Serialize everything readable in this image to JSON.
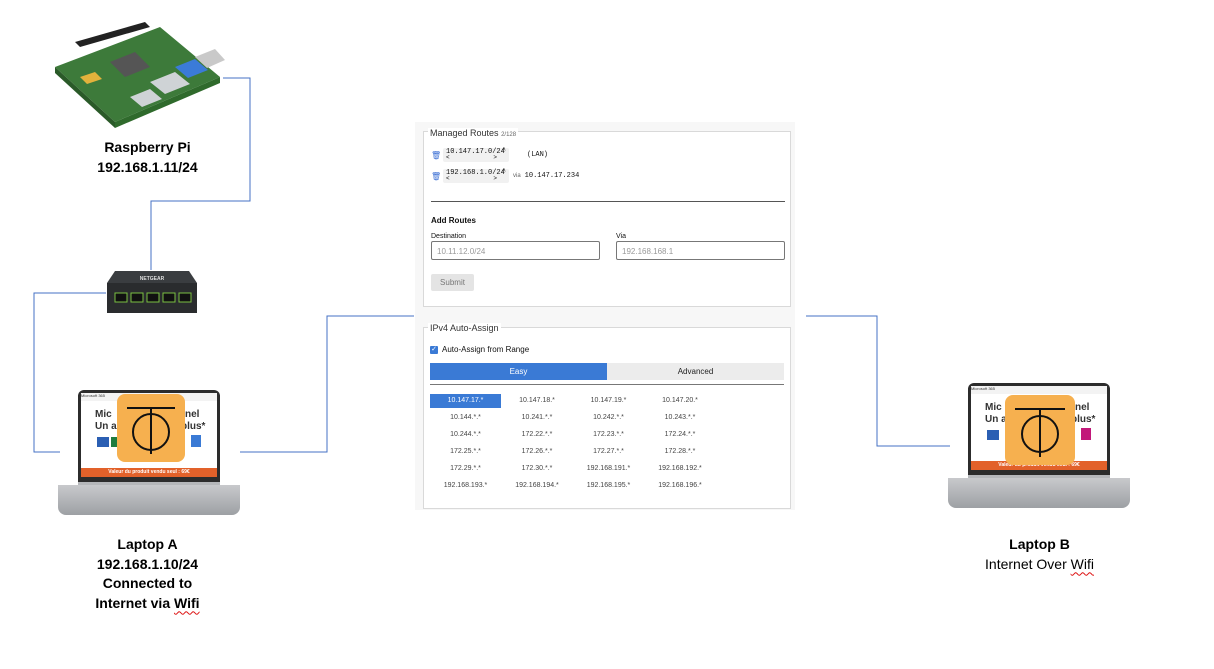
{
  "devices": {
    "raspberry_pi": {
      "name": "Raspberry Pi",
      "ip": "192.168.1.11/24"
    },
    "switch": {
      "brand": "NETGEAR"
    },
    "laptop_a": {
      "name": "Laptop A",
      "ip": "192.168.1.10/24",
      "note_line1": "Connected to",
      "note_line2_prefix": "Internet via ",
      "note_line2_word": "Wifi"
    },
    "laptop_b": {
      "name": "Laptop B",
      "note_prefix": "Internet Over ",
      "note_word": "Wifi"
    }
  },
  "laptop_screen": {
    "top_bar": "Microsoft 365",
    "headline_a": "Mic",
    "headline_b": "nel",
    "headline_c": "Un an",
    "headline_d": "plus*",
    "banner": "Valeur du produit vendu seul : 69€"
  },
  "panel": {
    "managed_routes": {
      "title": "Managed Routes",
      "count": "2/128",
      "routes": [
        {
          "value": "10.147.17.0/24",
          "via_label": "",
          "via": "(LAN)"
        },
        {
          "value": "192.168.1.0/24",
          "via_label": "via",
          "via": "10.147.17.234"
        }
      ]
    },
    "add_routes": {
      "title": "Add Routes",
      "destination_label": "Destination",
      "destination_placeholder": "10.11.12.0/24",
      "via_label": "Via",
      "via_placeholder": "192.168.168.1",
      "submit_label": "Submit"
    },
    "ipv4": {
      "title": "IPv4 Auto-Assign",
      "checkbox_label": "Auto-Assign from Range",
      "checked": true,
      "tabs": [
        "Easy",
        "Advanced"
      ],
      "active_tab": "Easy",
      "ranges": [
        "10.147.17.*",
        "10.147.18.*",
        "10.147.19.*",
        "10.147.20.*",
        "10.144.*.*",
        "10.241.*.*",
        "10.242.*.*",
        "10.243.*.*",
        "10.244.*.*",
        "172.22.*.*",
        "172.23.*.*",
        "172.24.*.*",
        "172.25.*.*",
        "172.26.*.*",
        "172.27.*.*",
        "172.28.*.*",
        "172.29.*.*",
        "172.30.*.*",
        "192.168.191.*",
        "192.168.192.*",
        "192.168.193.*",
        "192.168.194.*",
        "192.168.195.*",
        "192.168.196.*"
      ],
      "selected_range": "10.147.17.*"
    }
  },
  "colors": {
    "wire": "#4472c4",
    "accent": "#3a7ad5",
    "overlay_orange": "#f6b04f"
  }
}
